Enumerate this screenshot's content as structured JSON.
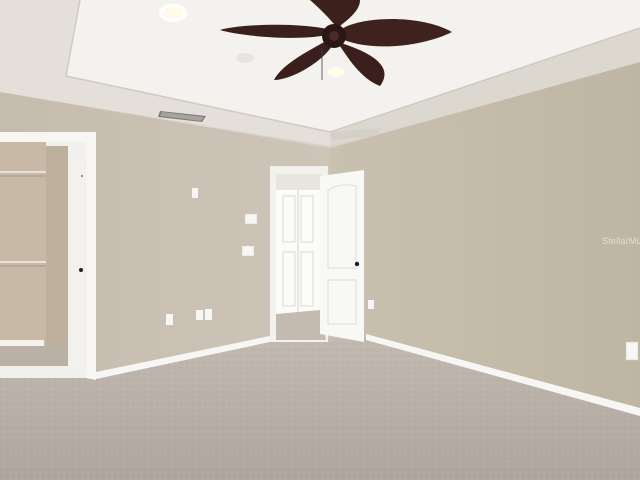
{
  "scene": {
    "description_type": "photo",
    "colors": {
      "wall_left": "#c8bfb1",
      "wall_right": "#c3baa9",
      "ceiling": "#ebe8e3",
      "tray_ceiling": "#f6f5f2",
      "carpet": "#b7aea6",
      "trim": "#fafafa",
      "fan_blade": "#3a1f1c"
    }
  },
  "watermark": {
    "text": "StellarMLS"
  }
}
